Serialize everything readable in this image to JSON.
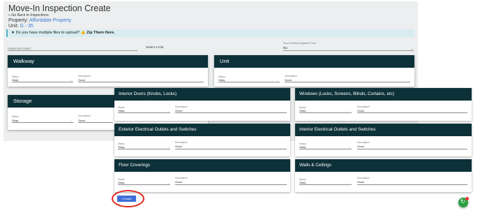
{
  "header": {
    "title": "Move-In Inspection Create",
    "back_link": "« Go Back to Inspections",
    "property_label": "Property:",
    "property_value": "Affordable Property",
    "unit_label": "Unit:",
    "unit_value": "G - 35"
  },
  "alert": {
    "text": "Do you have multiple files to upload?",
    "link": "Zip Them Here."
  },
  "form": {
    "inspection_date_label": "Inspection Date*",
    "file_label": "Select a File",
    "signature_label": "Show Resident Signature Field",
    "signature_value": "No"
  },
  "labels": {
    "status": "Status",
    "description": "Description*"
  },
  "cards": {
    "walkway": {
      "title": "Walkway",
      "status": "Okay",
      "description": "Good"
    },
    "unit": {
      "title": "Unit",
      "status": "Okay",
      "description": "Good"
    },
    "storage": {
      "title": "Storage",
      "status": "Okay",
      "description": "Good"
    },
    "interior_doors": {
      "title": "Interior Doors (Knobs, Locks)",
      "status": "Okay",
      "description": "Good"
    },
    "windows": {
      "title": "Windows (Locks, Screens, Blinds, Curtains, etc)",
      "status": "Okay",
      "description": "Good"
    },
    "exterior_electrical": {
      "title": "Exterior Electrical Outlets and Switches",
      "status": "Okay",
      "description": "Good"
    },
    "interior_electrical": {
      "title": "Interior Electrical Outlets and Switches",
      "status": "Okay",
      "description": "Good"
    },
    "floor_coverings": {
      "title": "Floor Coverings",
      "status": "Okay",
      "description": "Good"
    },
    "walls_ceilings": {
      "title": "Walls & Ceilings",
      "status": "Okay",
      "description": "Good"
    }
  },
  "create_button": {
    "label": "Create"
  },
  "colors": {
    "card_header": "#0d3138",
    "primary": "#3f6ed8",
    "highlight": "#e02a1f",
    "fab": "#2ea043"
  }
}
